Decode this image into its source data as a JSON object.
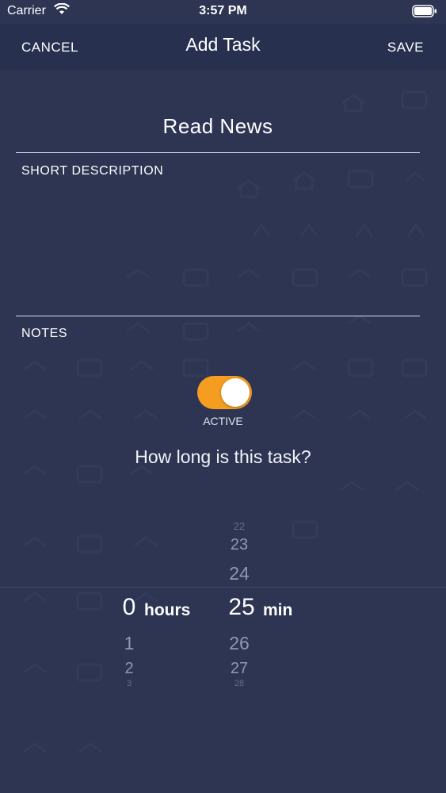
{
  "status_bar": {
    "carrier": "Carrier",
    "time": "3:57 PM"
  },
  "nav": {
    "cancel_label": "CANCEL",
    "title": "Add Task",
    "save_label": "SAVE"
  },
  "form": {
    "task_name": "Read News",
    "short_description_label": "SHORT DESCRIPTION",
    "notes_label": "NOTES",
    "active_label": "ACTIVE",
    "active": true,
    "duration_question": "How long is this task?"
  },
  "picker": {
    "hours": {
      "above": [],
      "selected": "0",
      "unit": "hours",
      "below": [
        "1",
        "2",
        "3"
      ]
    },
    "minutes": {
      "above": [
        "22",
        "23",
        "24"
      ],
      "selected": "25",
      "unit": "min",
      "below": [
        "26",
        "27",
        "28"
      ]
    }
  },
  "colors": {
    "background": "#2d3553",
    "nav_background": "#283050",
    "toggle_on": "#f59d21",
    "text": "#ffffff"
  }
}
